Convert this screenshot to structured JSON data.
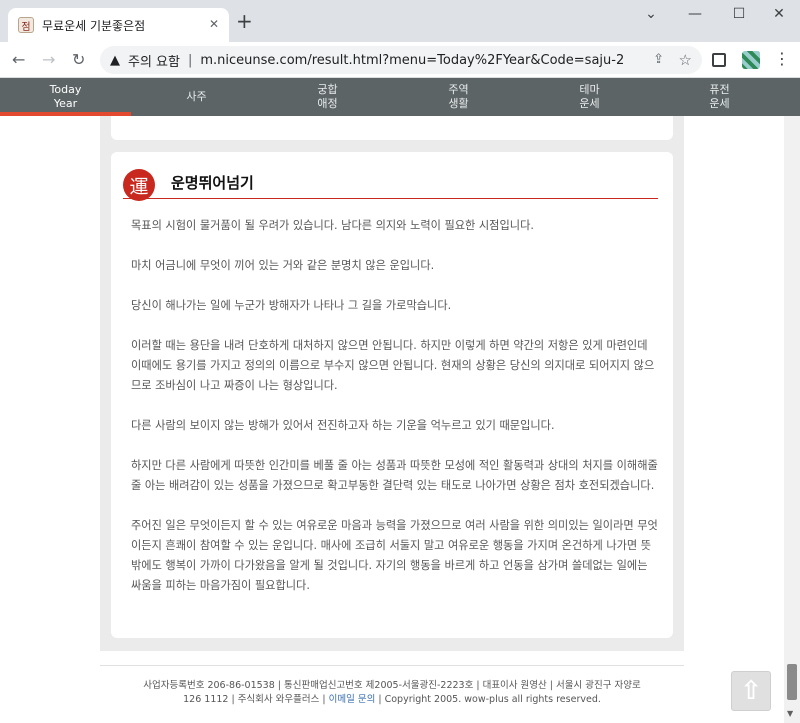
{
  "browser": {
    "tab_title": "무료운세 기분좋은점",
    "tab_favicon": "점",
    "close_glyph": "✕",
    "new_tab_glyph": "+",
    "security_label": "주의 요함",
    "url": "m.niceunse.com/result.html?menu=Today%2FYear&Code=saju-2"
  },
  "site_nav": {
    "items": [
      {
        "line1": "Today",
        "line2": "Year"
      },
      {
        "line1": "사주",
        "line2": ""
      },
      {
        "line1": "궁합",
        "line2": "애정"
      },
      {
        "line1": "주역",
        "line2": "생활"
      },
      {
        "line1": "테마",
        "line2": "운세"
      },
      {
        "line1": "퓨전",
        "line2": "운세"
      }
    ],
    "active_color": "#e2492f"
  },
  "card": {
    "seal_char": "運",
    "title": "운명뛰어넘기",
    "paragraphs": [
      "목표의 시험이 물거품이 될 우려가 있습니다. 남다른 의지와 노력이 필요한 시점입니다.",
      "마치 어금니에 무엇이 끼어 있는 거와 같은 분명치 않은 운입니다.",
      "당신이 해나가는 일에 누군가 방해자가 나타나 그 길을 가로막습니다.",
      "이러할 때는 용단을 내려 단호하게 대처하지 않으면 안됩니다. 하지만 이렇게 하면 약간의 저항은 있게 마련인데 이때에도 용기를 가지고 정의의 이름으로 부수지 않으면 안됩니다. 현재의 상황은 당신의 의지대로 되어지지 않으므로 조바심이 나고 짜증이 나는 형상입니다.",
      "다른 사람의 보이지 않는 방해가 있어서 전진하고자 하는 기운을 억누르고 있기 때문입니다.",
      "하지만 다른 사람에게 따뜻한 인간미를 베풀 줄 아는 성품과 따뜻한 모성에 적인 활동력과 상대의 처지를 이해해줄 줄 아는 배려감이 있는 성품을 가졌으므로 확고부동한 결단력 있는 태도로 나아가면 상황은 점차 호전되겠습니다.",
      "주어진 일은 무엇이든지 할 수 있는 여유로운 마음과 능력을 가졌으므로 여러 사람을 위한 의미있는 일이라면 무엇이든지 흔쾌이 참여할 수 있는 운입니다. 매사에 조급히 서둘지 말고 여유로운 행동을 가지며 온건하게 나가면 뜻밖에도 행복이 가까이 다가왔음을 알게 될 것입니다. 자기의 행동을 바르게 하고 언동을 삼가며 쓸데없는 일에는 싸움을 피하는 마음가짐이 필요합니다."
    ]
  },
  "footer": {
    "line1": "사업자등록번호 206-86-01538 | 통신판매업신고번호 제2005-서울광진-2223호 | 대표이사 원영산 | 서울시 광진구 자양로",
    "line2_a": "126 1112 | 주식회사 와우플러스 | ",
    "email_link": "이메일 문의",
    "line2_b": " | Copyright 2005. wow-plus all rights reserved."
  },
  "icons": {
    "back": "back-arrow-icon",
    "forward": "forward-arrow-icon",
    "reload": "reload-icon",
    "warning": "warning-icon",
    "share": "share-icon",
    "star": "bookmark-star-icon",
    "to_top": "up-arrow-icon"
  }
}
